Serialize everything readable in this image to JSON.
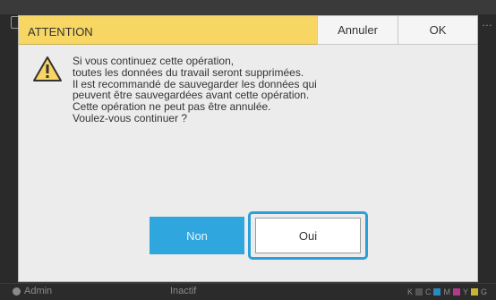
{
  "dialog": {
    "title": "ATTENTION",
    "cancel_label": "Annuler",
    "ok_label": "OK",
    "icon": "warning-icon",
    "message_lines": [
      "Si vous continuez cette opération,",
      "toutes les données du travail seront supprimées.",
      "Il est recommandé de sauvegarder les données qui",
      "peuvent être sauvegardées avant cette opération.",
      "Cette opération ne peut pas être annulée.",
      "Voulez-vous continuer ?"
    ],
    "no_label": "Non",
    "yes_label": "Oui"
  },
  "status_bar": {
    "user": "Admin",
    "state": "Inactif",
    "inks": [
      "K",
      "C",
      "M",
      "Y",
      "G"
    ]
  },
  "colors": {
    "title_bar": "#f7d664",
    "no_button": "#2fa6de",
    "focus_ring": "#2a9fd8",
    "dialog_bg": "#ececec"
  }
}
